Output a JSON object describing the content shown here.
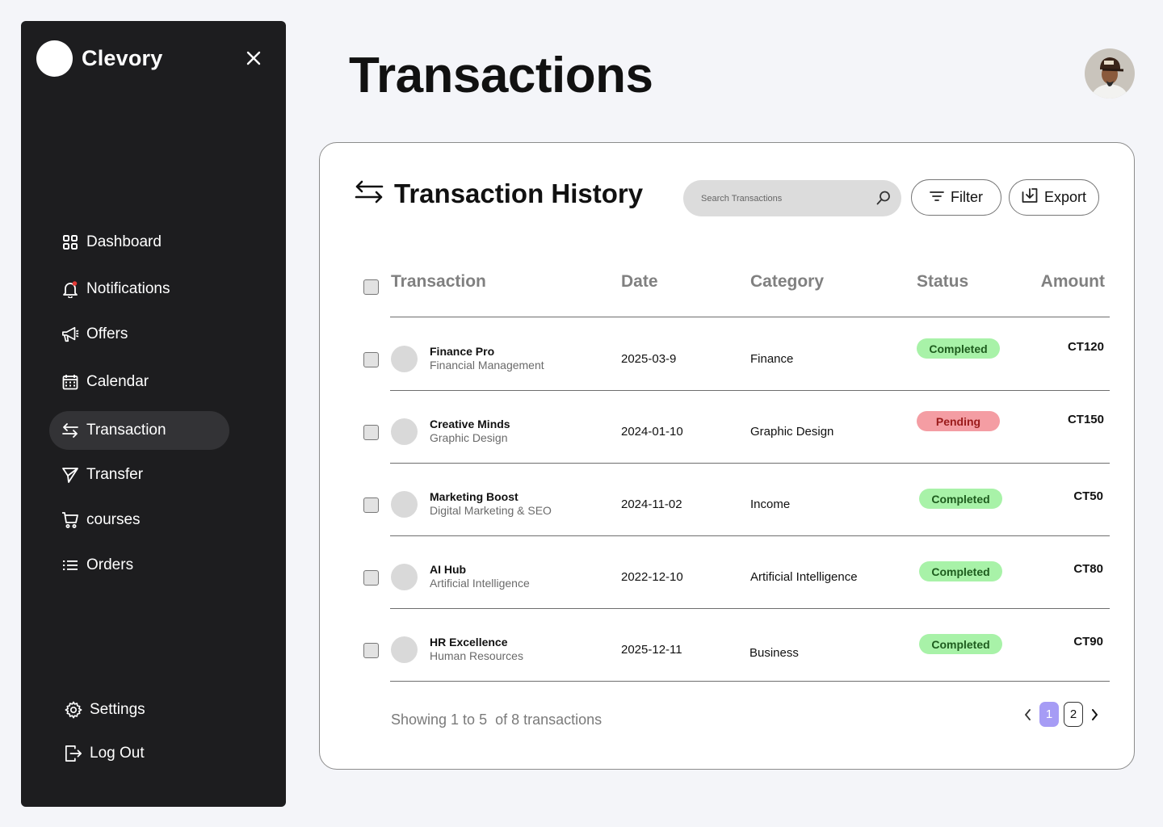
{
  "brand": {
    "name": "Clevory"
  },
  "sidebar": {
    "items": [
      {
        "label": "Dashboard",
        "icon": "dashboard-grid-icon"
      },
      {
        "label": "Notifications",
        "icon": "bell-icon"
      },
      {
        "label": "Offers",
        "icon": "megaphone-icon"
      },
      {
        "label": "Calendar",
        "icon": "calendar-icon"
      },
      {
        "label": "Transaction",
        "icon": "swap-arrows-icon",
        "active": true
      },
      {
        "label": "Transfer",
        "icon": "send-icon"
      },
      {
        "label": "courses",
        "icon": "cart-icon"
      },
      {
        "label": "Orders",
        "icon": "list-icon"
      }
    ],
    "settings_label": "Settings",
    "logout_label": "Log Out"
  },
  "header": {
    "title": "Transactions"
  },
  "card": {
    "title": "Transaction History",
    "search_placeholder": "Search Transactions",
    "filter_label": "Filter",
    "export_label": "Export"
  },
  "table": {
    "columns": [
      "Transaction",
      "Date",
      "Category",
      "Status",
      "Amount"
    ],
    "rows": [
      {
        "name": "Finance Pro",
        "sub": "Financial Management",
        "date": "2025-03-9",
        "category": "Finance",
        "status": "Completed",
        "amount": "CT120"
      },
      {
        "name": "Creative Minds",
        "sub": "Graphic Design",
        "date": "2024-01-10",
        "category": "Graphic Design",
        "status": "Pending",
        "amount": "CT150"
      },
      {
        "name": "Marketing Boost",
        "sub": "Digital Marketing & SEO",
        "date": "2024-11-02",
        "category": "Income",
        "status": "Completed",
        "amount": "CT50"
      },
      {
        "name": "AI Hub",
        "sub": "Artificial Intelligence",
        "date": "2022-12-10",
        "category": "Artificial Intelligence",
        "status": "Completed",
        "amount": "CT80"
      },
      {
        "name": "HR Excellence",
        "sub": "Human Resources",
        "date": "2025-12-11",
        "category": "Business",
        "status": "Completed",
        "amount": "CT90"
      }
    ]
  },
  "footer": {
    "showing": "Showing 1 to 5  of 8 transactions",
    "pages": [
      "1",
      "2"
    ],
    "current_page": "1"
  },
  "colors": {
    "sidebar_bg": "#1d1d1f",
    "active_item_bg": "#333336",
    "completed_bg": "#a8f2a8",
    "pending_bg": "#f49da3",
    "page_active": "#a69cf5",
    "notification_dot": "#e53935"
  }
}
